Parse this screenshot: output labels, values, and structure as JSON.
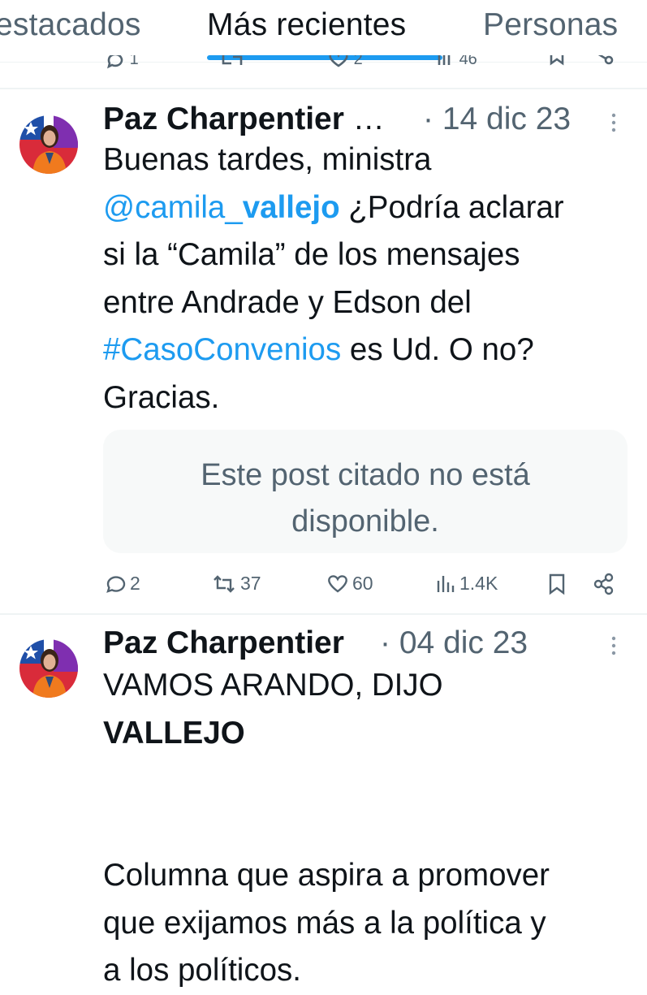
{
  "tabs": [
    {
      "label": "estacados",
      "active": false
    },
    {
      "label": "Más recientes",
      "active": true
    },
    {
      "label": "Personas",
      "active": false
    }
  ],
  "previous_tweet": {
    "replies": "1",
    "likes": "2",
    "views": "46"
  },
  "tweets": [
    {
      "author": "Paz Charpentier",
      "name_ellipsis": " …",
      "date": "· 14 dic 23",
      "text": {
        "line1": "Buenas tardes, ministra",
        "mention_a": "@camila_",
        "mention_b": "vallejo",
        "line2_rest": " ¿Podría aclarar",
        "line3": "si la “Camila” de los mensajes",
        "line4": "entre Andrade y Edson del",
        "hashtag": "#CasoConvenios",
        "line5_rest": " es Ud. O no?",
        "line6": "Gracias."
      },
      "quote": {
        "line1": "Este post citado no está",
        "line2": "disponible."
      },
      "actions": {
        "replies": "2",
        "reposts": "37",
        "likes": "60",
        "views": "1.4K"
      }
    },
    {
      "author": "Paz Charpentier",
      "date": "· 04 dic 23",
      "text": {
        "line1": "VAMOS ARANDO, DIJO",
        "line2": "VALLEJO",
        "line3": "Columna que aspira a promover",
        "line4": "que exijamos más a la política y",
        "line5": "a los políticos."
      }
    }
  ],
  "colors": {
    "accent": "#1d9bf0",
    "text_primary": "#0f1419",
    "text_secondary": "#536471",
    "divider": "#eff3f4",
    "quote_bg": "#f7f9f9"
  }
}
